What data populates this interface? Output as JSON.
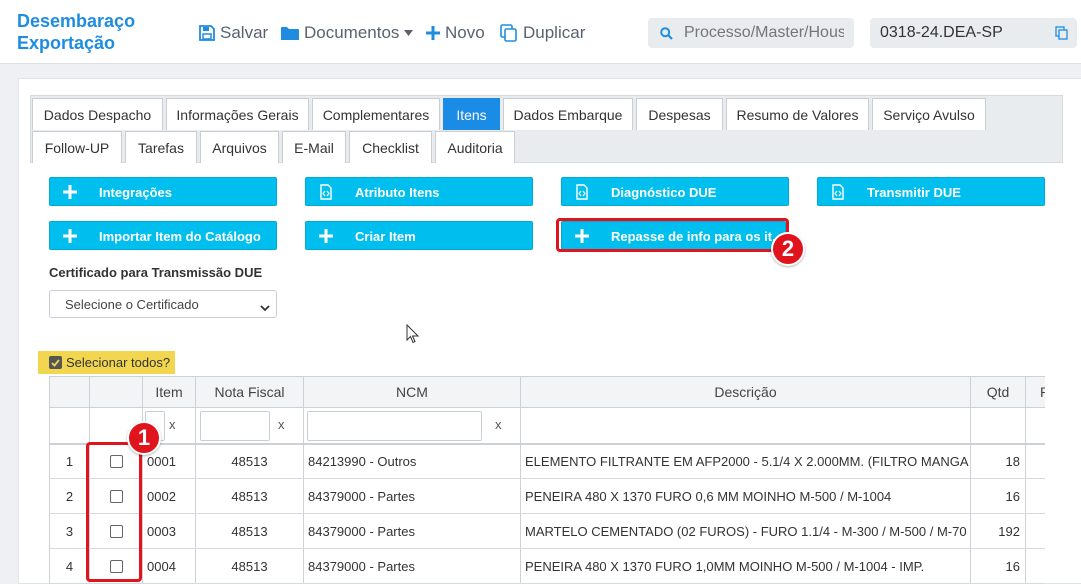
{
  "header": {
    "title_line1": "Desembaraço",
    "title_line2": "Exportação",
    "save_label": "Salvar",
    "documents_label": "Documentos",
    "new_label": "Novo",
    "duplicate_label": "Duplicar",
    "search_placeholder": "Processo/Master/House",
    "process_number": "0318-24.DEA-SP"
  },
  "tabs_row1": [
    "Dados Despacho",
    "Informações Gerais",
    "Complementares",
    "Itens",
    "Dados Embarque",
    "Despesas",
    "Resumo de Valores",
    "Serviço Avulso"
  ],
  "tabs_row2": [
    "Follow-UP",
    "Tarefas",
    "Arquivos",
    "E-Mail",
    "Checklist",
    "Auditoria"
  ],
  "active_tab": "Itens",
  "actions": {
    "integracoes": "Integrações",
    "atributo_itens": "Atributo Itens",
    "diagnostico_due": "Diagnóstico DUE",
    "transmitir_due": "Transmitir DUE",
    "importar_item": "Importar Item do Catálogo",
    "criar_item": "Criar Item",
    "repasse_info": "Repasse de info para os it..."
  },
  "certificate": {
    "label": "Certificado para Transmissão DUE",
    "selected": "Selecione o Certificado"
  },
  "select_all_label": "Selecionar todos?",
  "table": {
    "headers": {
      "item": "Item",
      "nota_fiscal": "Nota Fiscal",
      "ncm": "NCM",
      "descricao": "Descrição",
      "qtd": "Qtd",
      "extra": "P"
    },
    "filter_clear": "x",
    "rows": [
      {
        "n": "1",
        "item": "0001",
        "nota_fiscal": "48513",
        "ncm": "84213990 - Outros",
        "descricao": "ELEMENTO FILTRANTE EM AFP2000 - 5.1/4 X 2.000MM. (FILTRO MANGA",
        "qtd": "18"
      },
      {
        "n": "2",
        "item": "0002",
        "nota_fiscal": "48513",
        "ncm": "84379000 - Partes",
        "descricao": "PENEIRA 480 X 1370 FURO 0,6 MM MOINHO M-500 / M-1004",
        "qtd": "16"
      },
      {
        "n": "3",
        "item": "0003",
        "nota_fiscal": "48513",
        "ncm": "84379000 - Partes",
        "descricao": "MARTELO CEMENTADO (02 FUROS) - FURO 1.1/4 - M-300 / M-500 / M-70",
        "qtd": "192"
      },
      {
        "n": "4",
        "item": "0004",
        "nota_fiscal": "48513",
        "ncm": "84379000 - Partes",
        "descricao": "PENEIRA 480 X 1370 FURO 1,0MM MOINHO M-500 / M-1004 - IMP.",
        "qtd": "16"
      }
    ]
  },
  "annotations": {
    "badge_1": "1",
    "badge_2": "2"
  },
  "colors": {
    "brand": "#1e8de0",
    "action": "#00bfef",
    "active_tab": "#1a8ce6",
    "highlight": "#e0141c",
    "select_all_bg": "#f3d64f"
  }
}
